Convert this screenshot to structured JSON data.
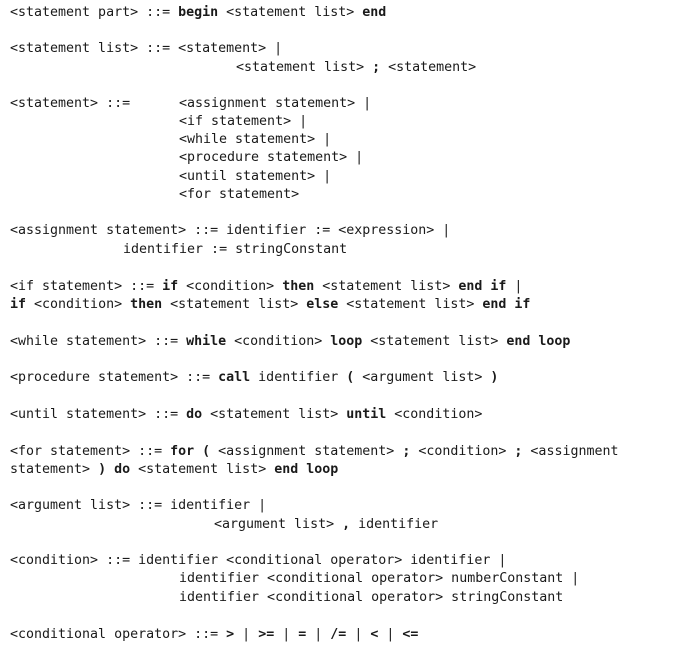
{
  "grammar": {
    "statement_part": {
      "l1": [
        "<statement part> ::= ",
        "begin",
        " <statement list> ",
        "end"
      ]
    },
    "statement_list": {
      "l1": "<statement list> ::= <statement> |",
      "l2": [
        "<statement list> ",
        ";",
        " <statement>"
      ]
    },
    "statement": {
      "head": "<statement> ::=",
      "alts": [
        "<assignment statement> |",
        "<if statement> |",
        "<while statement> |",
        "<procedure statement> |",
        "<until statement> |",
        "<for statement>"
      ]
    },
    "assignment": {
      "l1": "<assignment statement> ::= identifier := <expression> |",
      "l2": "identifier := stringConstant"
    },
    "if_stmt": {
      "l1": [
        "<if statement> ::= ",
        "if",
        " <condition> ",
        "then",
        " <statement list> ",
        "end if",
        " |"
      ],
      "l2": [
        "if",
        " <condition> ",
        "then",
        " <statement list> ",
        "else",
        " <statement list> ",
        "end if"
      ]
    },
    "while_stmt": {
      "l1": [
        "<while statement> ::= ",
        "while",
        " <condition> ",
        "loop",
        " <statement list> ",
        "end loop"
      ]
    },
    "procedure_stmt": {
      "l1": [
        "<procedure statement> ::= ",
        "call",
        " identifier ",
        "(",
        " <argument list> ",
        ")"
      ]
    },
    "until_stmt": {
      "l1": [
        "<until statement> ::= ",
        "do",
        " <statement list> ",
        "until",
        " <condition>"
      ]
    },
    "for_stmt": {
      "l1": [
        "<for statement> ::= ",
        "for",
        " ",
        "(",
        " <assignment statement> ",
        ";",
        " <condition> ",
        ";",
        " <assignment"
      ],
      "l2": [
        "statement> ",
        ")",
        " ",
        "do",
        " <statement list> ",
        "end loop"
      ]
    },
    "argument_list": {
      "l1": "<argument list> ::= identifier |",
      "l2": [
        "<argument list> ",
        ",",
        " identifier"
      ]
    },
    "condition": {
      "l1": "<condition> ::= identifier <conditional operator> identifier |",
      "l2": "identifier <conditional operator> numberConstant |",
      "l3": "identifier <conditional operator> stringConstant"
    },
    "conditional_operator": {
      "l1": [
        "<conditional operator> ::= ",
        ">",
        " | ",
        ">=",
        " | ",
        "=",
        " | ",
        "/=",
        " | ",
        "<",
        " | ",
        "<="
      ]
    }
  }
}
